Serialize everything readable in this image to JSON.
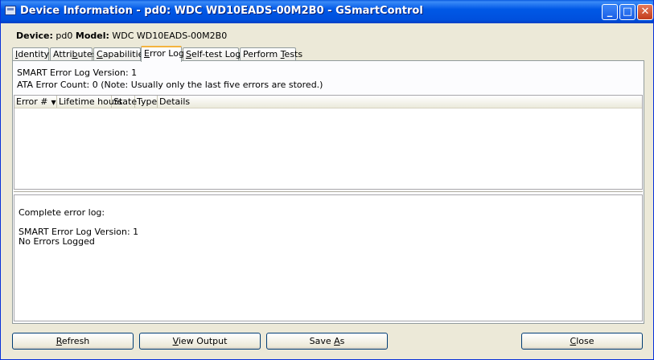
{
  "window": {
    "title": "Device Information - pd0: WDC WD10EADS-00M2B0 - GSmartControl",
    "title_buttons": {
      "minimize": "_",
      "maximize": "□",
      "close": "✕"
    }
  },
  "device": {
    "device_label": "Device:",
    "device_value": "pd0",
    "model_label": "Model:",
    "model_value": "WDC WD10EADS-00M2B0"
  },
  "tabs": [
    {
      "pre": "",
      "u": "I",
      "post": "dentity"
    },
    {
      "pre": "Attri",
      "u": "b",
      "post": "utes"
    },
    {
      "pre": "",
      "u": "C",
      "post": "apabilities"
    },
    {
      "pre": "",
      "u": "E",
      "post": "rror Log"
    },
    {
      "pre": "",
      "u": "S",
      "post": "elf-test Logs"
    },
    {
      "pre": "Perform ",
      "u": "T",
      "post": "ests"
    }
  ],
  "error_log": {
    "version_line": "SMART Error Log Version: 1",
    "count_line": "ATA Error Count: 0 (Note: Usually only the last five errors are stored.)",
    "columns": [
      "Error #",
      "Lifetime hours",
      "State",
      "Type",
      "Details"
    ],
    "sort_indicator": "▼",
    "complete_log_lines": [
      "Complete error log:",
      "",
      "SMART Error Log Version: 1",
      "No Errors Logged"
    ]
  },
  "buttons": {
    "refresh": {
      "pre": "",
      "u": "R",
      "post": "efresh"
    },
    "view_output": {
      "pre": "",
      "u": "V",
      "post": "iew Output"
    },
    "save_as": {
      "pre": "Save ",
      "u": "A",
      "post": "s"
    },
    "close": {
      "pre": "",
      "u": "C",
      "post": "lose"
    }
  }
}
